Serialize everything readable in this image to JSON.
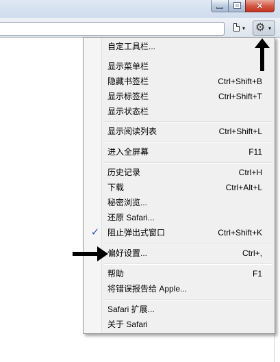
{
  "toolbar": {
    "page_menu_icon": "page-icon",
    "settings_icon": "gear-icon",
    "gear_glyph": "⚙",
    "caret_glyph": "▾"
  },
  "window_controls": {
    "close_glyph": "✕"
  },
  "menu": {
    "checkmark_glyph": "✓",
    "accent_color": "#2a5db0",
    "items": [
      {
        "label": "自定工具栏...",
        "shortcut": ""
      },
      {
        "label": "显示菜单栏",
        "shortcut": ""
      },
      {
        "label": "隐藏书签栏",
        "shortcut": "Ctrl+Shift+B"
      },
      {
        "label": "显示标签栏",
        "shortcut": "Ctrl+Shift+T"
      },
      {
        "label": "显示状态栏",
        "shortcut": ""
      },
      {
        "label": "显示阅读列表",
        "shortcut": "Ctrl+Shift+L"
      },
      {
        "label": "进入全屏幕",
        "shortcut": "F11"
      },
      {
        "label": "历史记录",
        "shortcut": "Ctrl+H"
      },
      {
        "label": "下载",
        "shortcut": "Ctrl+Alt+L"
      },
      {
        "label": "秘密浏览...",
        "shortcut": ""
      },
      {
        "label": "还原 Safari...",
        "shortcut": ""
      },
      {
        "label": "阻止弹出式窗口",
        "shortcut": "Ctrl+Shift+K",
        "checked": true
      },
      {
        "label": "偏好设置...",
        "shortcut": "Ctrl+,"
      },
      {
        "label": "帮助",
        "shortcut": "F1"
      },
      {
        "label": "将错误报告给 Apple...",
        "shortcut": ""
      },
      {
        "label": "Safari 扩展...",
        "shortcut": ""
      },
      {
        "label": "关于 Safari",
        "shortcut": ""
      }
    ]
  },
  "annotations": {
    "arrow_color": "#000000"
  }
}
